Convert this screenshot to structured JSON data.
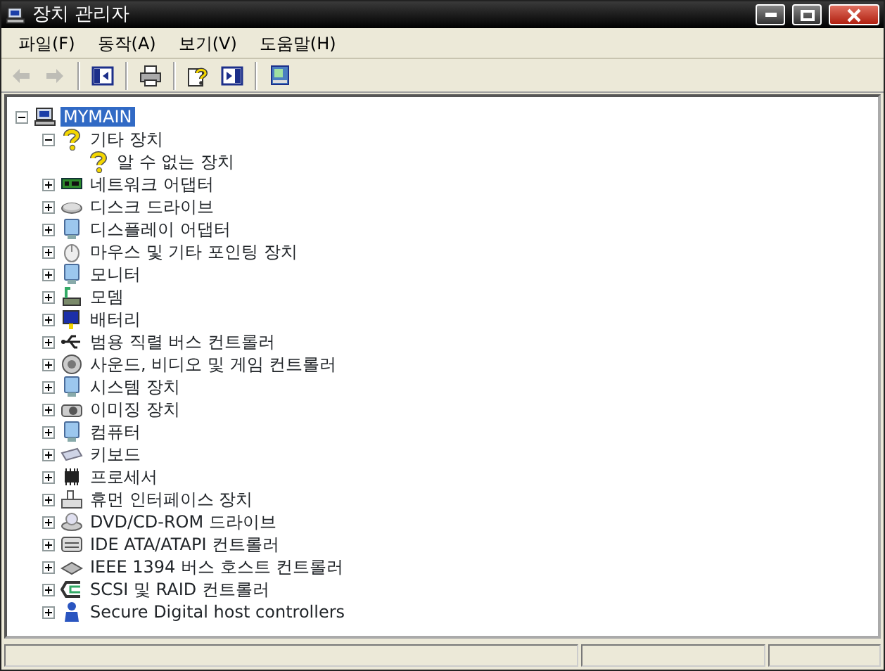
{
  "window": {
    "title": "장치 관리자"
  },
  "menu": [
    "파일(F)",
    "동작(A)",
    "보기(V)",
    "도움말(H)"
  ],
  "toolbar": [
    {
      "disabled": true
    },
    {
      "disabled": true
    },
    {
      "disabled": false
    },
    {
      "disabled": false
    },
    {
      "disabled": false
    },
    {
      "disabled": false
    },
    {
      "disabled": false
    }
  ],
  "tree": {
    "label": "MYMAIN",
    "selected": true,
    "expanded": true,
    "children": [
      {
        "label": "기타 장치",
        "selected": false,
        "expanded": true,
        "children": [
          {
            "label": "알 수 없는 장치",
            "selected": false
          }
        ]
      },
      {
        "label": "네트워크 어댑터",
        "selected": false,
        "expanded": false
      },
      {
        "label": "디스크 드라이브",
        "selected": false,
        "expanded": false
      },
      {
        "label": "디스플레이 어댑터",
        "selected": false,
        "expanded": false
      },
      {
        "label": "마우스 및 기타 포인팅 장치",
        "selected": false,
        "expanded": false
      },
      {
        "label": "모니터",
        "selected": false,
        "expanded": false
      },
      {
        "label": "모뎀",
        "selected": false,
        "expanded": false
      },
      {
        "label": "배터리",
        "selected": false,
        "expanded": false
      },
      {
        "label": "범용 직렬 버스 컨트롤러",
        "selected": false,
        "expanded": false
      },
      {
        "label": "사운드, 비디오 및 게임 컨트롤러",
        "selected": false,
        "expanded": false
      },
      {
        "label": "시스템 장치",
        "selected": false,
        "expanded": false
      },
      {
        "label": "이미징 장치",
        "selected": false,
        "expanded": false
      },
      {
        "label": "컴퓨터",
        "selected": false,
        "expanded": false
      },
      {
        "label": "키보드",
        "selected": false,
        "expanded": false
      },
      {
        "label": "프로세서",
        "selected": false,
        "expanded": false
      },
      {
        "label": "휴먼 인터페이스 장치",
        "selected": false,
        "expanded": false
      },
      {
        "label": "DVD/CD-ROM 드라이브",
        "selected": false,
        "expanded": false
      },
      {
        "label": "IDE ATA/ATAPI 컨트롤러",
        "selected": false,
        "expanded": false
      },
      {
        "label": "IEEE 1394 버스 호스트 컨트롤러",
        "selected": false,
        "expanded": false
      },
      {
        "label": "SCSI 및 RAID 컨트롤러",
        "selected": false,
        "expanded": false
      },
      {
        "label": "Secure Digital host controllers",
        "selected": false,
        "expanded": false
      }
    ]
  }
}
